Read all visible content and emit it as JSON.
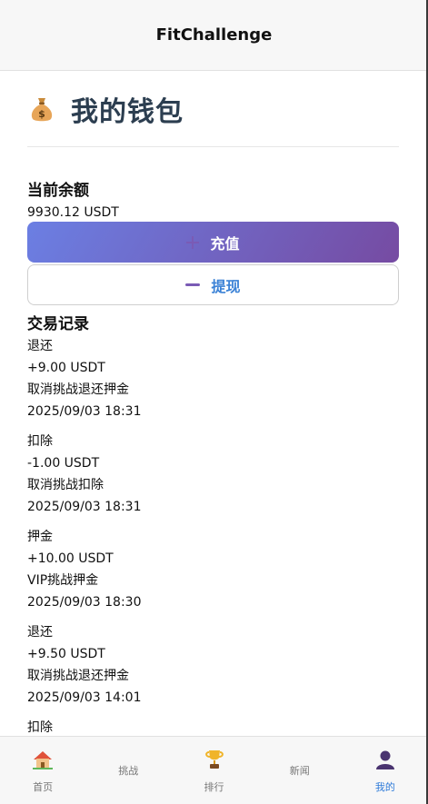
{
  "header": {
    "title": "FitChallenge"
  },
  "wallet": {
    "title": "我的钱包",
    "balance_label": "当前余额",
    "balance_value": "9930.12 USDT",
    "deposit_label": "充值",
    "withdraw_label": "提现"
  },
  "transactions": {
    "title": "交易记录",
    "items": [
      {
        "type": "退还",
        "amount": "+9.00 USDT",
        "note": "取消挑战退还押金",
        "time": "2025/09/03 18:31"
      },
      {
        "type": "扣除",
        "amount": "-1.00 USDT",
        "note": "取消挑战扣除",
        "time": "2025/09/03 18:31"
      },
      {
        "type": "押金",
        "amount": "+10.00 USDT",
        "note": "VIP挑战押金",
        "time": "2025/09/03 18:30"
      },
      {
        "type": "退还",
        "amount": "+9.50 USDT",
        "note": "取消挑战退还押金",
        "time": "2025/09/03 14:01"
      },
      {
        "type": "扣除"
      }
    ]
  },
  "tabbar": {
    "items": [
      {
        "label": "首页",
        "icon": "house-icon"
      },
      {
        "label": "挑战",
        "icon": ""
      },
      {
        "label": "排行",
        "icon": "trophy-icon"
      },
      {
        "label": "新闻",
        "icon": ""
      },
      {
        "label": "我的",
        "icon": "user-icon",
        "active": true
      }
    ]
  },
  "colors": {
    "accent_start": "#6b7fe3",
    "accent_end": "#764ba2",
    "active_tab": "#2f7bd9",
    "title": "#2c3e50"
  }
}
